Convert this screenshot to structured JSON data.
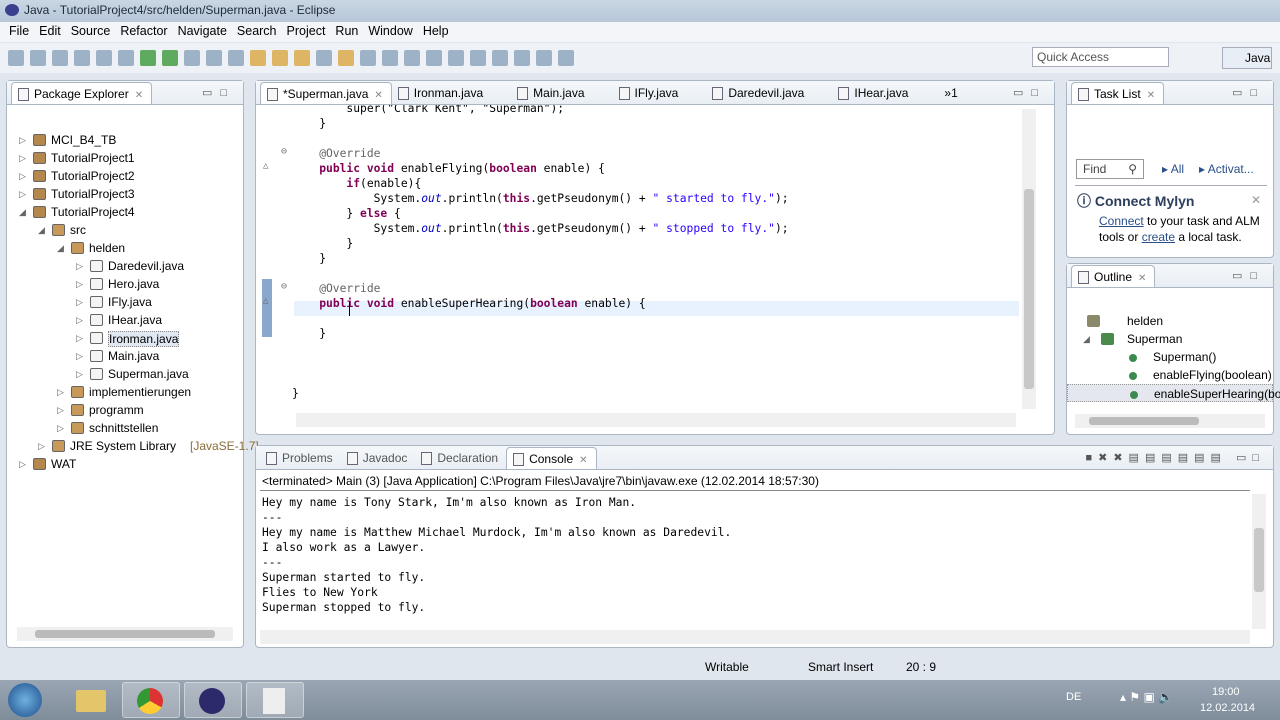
{
  "window": {
    "title": "Java - TutorialProject4/src/helden/Superman.java - Eclipse"
  },
  "menu": [
    "File",
    "Edit",
    "Source",
    "Refactor",
    "Navigate",
    "Search",
    "Project",
    "Run",
    "Window",
    "Help"
  ],
  "quick_access": {
    "placeholder": "Quick Access"
  },
  "perspective": "Java",
  "package_explorer": {
    "title": "Package Explorer",
    "items": [
      {
        "label": "MCI_B4_TB",
        "level": 0,
        "twisty": "closed"
      },
      {
        "label": "TutorialProject1",
        "level": 0,
        "twisty": "closed"
      },
      {
        "label": "TutorialProject2",
        "level": 0,
        "twisty": "closed"
      },
      {
        "label": "TutorialProject3",
        "level": 0,
        "twisty": "closed"
      },
      {
        "label": "TutorialProject4",
        "level": 0,
        "twisty": "open"
      },
      {
        "label": "src",
        "level": 1,
        "twisty": "open"
      },
      {
        "label": "helden",
        "level": 2,
        "twisty": "open"
      },
      {
        "label": "Daredevil.java",
        "level": 3,
        "twisty": "closed"
      },
      {
        "label": "Hero.java",
        "level": 3,
        "twisty": "closed"
      },
      {
        "label": "IFly.java",
        "level": 3,
        "twisty": "closed"
      },
      {
        "label": "IHear.java",
        "level": 3,
        "twisty": "closed"
      },
      {
        "label": "Ironman.java",
        "level": 3,
        "twisty": "closed",
        "selected": true
      },
      {
        "label": "Main.java",
        "level": 3,
        "twisty": "closed"
      },
      {
        "label": "Superman.java",
        "level": 3,
        "twisty": "closed"
      },
      {
        "label": "implementierungen",
        "level": 2,
        "twisty": "closed"
      },
      {
        "label": "programm",
        "level": 2,
        "twisty": "closed"
      },
      {
        "label": "schnittstellen",
        "level": 2,
        "twisty": "closed"
      },
      {
        "label": "JRE System Library",
        "suffix": "[JavaSE-1.7]",
        "level": 1,
        "twisty": "closed"
      },
      {
        "label": "WAT",
        "level": 0,
        "twisty": "closed"
      }
    ]
  },
  "editor": {
    "tabs": [
      "*Superman.java",
      "Ironman.java",
      "Main.java",
      "IFly.java",
      "Daredevil.java",
      "IHear.java"
    ],
    "overflow": "»1",
    "lines": [
      {
        "row": 0,
        "seg": [
          [
            "        super(\"Clark Kent\", \"Superman\");",
            ""
          ]
        ]
      },
      {
        "row": 1,
        "seg": [
          [
            "    }",
            ""
          ]
        ]
      },
      {
        "row": 3,
        "seg": [
          [
            "    @Override",
            "an"
          ]
        ]
      },
      {
        "row": 4,
        "seg": [
          [
            "    ",
            ""
          ],
          [
            "public void",
            "kw"
          ],
          [
            " enableFlying(",
            ""
          ],
          [
            "boolean",
            "kw"
          ],
          [
            " enable) {",
            ""
          ]
        ]
      },
      {
        "row": 5,
        "seg": [
          [
            "        ",
            ""
          ],
          [
            "if",
            "kw"
          ],
          [
            "(enable){",
            ""
          ]
        ]
      },
      {
        "row": 6,
        "seg": [
          [
            "            System.",
            ""
          ],
          [
            "out",
            "it"
          ],
          [
            ".println(",
            ""
          ],
          [
            "this",
            "kw"
          ],
          [
            ".getPseudonym() + ",
            ""
          ],
          [
            "\" started to fly.\"",
            "st"
          ],
          [
            ");",
            ""
          ]
        ]
      },
      {
        "row": 7,
        "seg": [
          [
            "        } ",
            ""
          ],
          [
            "else",
            "kw"
          ],
          [
            " {",
            ""
          ]
        ]
      },
      {
        "row": 8,
        "seg": [
          [
            "            System.",
            ""
          ],
          [
            "out",
            "it"
          ],
          [
            ".println(",
            ""
          ],
          [
            "this",
            "kw"
          ],
          [
            ".getPseudonym() + ",
            ""
          ],
          [
            "\" stopped to fly.\"",
            "st"
          ],
          [
            ");",
            ""
          ]
        ]
      },
      {
        "row": 9,
        "seg": [
          [
            "        }",
            ""
          ]
        ]
      },
      {
        "row": 10,
        "seg": [
          [
            "    }",
            ""
          ]
        ]
      },
      {
        "row": 12,
        "seg": [
          [
            "    @Override",
            "an"
          ]
        ]
      },
      {
        "row": 13,
        "seg": [
          [
            "    ",
            ""
          ],
          [
            "public void",
            "kw"
          ],
          [
            " enableSuperHearing(",
            ""
          ],
          [
            "boolean",
            "kw"
          ],
          [
            " enable) {",
            ""
          ]
        ]
      },
      {
        "row": 14,
        "seg": [
          [
            "        ",
            ""
          ]
        ]
      },
      {
        "row": 15,
        "seg": [
          [
            "    }",
            ""
          ]
        ]
      },
      {
        "row": 19,
        "seg": [
          [
            "}",
            ""
          ]
        ]
      }
    ]
  },
  "task_list": {
    "title": "Task List",
    "find_placeholder": "Find",
    "filter_all": "All",
    "filter_activate": "Activat...",
    "mylyn_title": "Connect Mylyn",
    "mylyn_link1": "Connect",
    "mylyn_text1": " to your task and ALM tools or ",
    "mylyn_link2": "create",
    "mylyn_text2": " a local task."
  },
  "outline": {
    "title": "Outline",
    "items": [
      {
        "label": "helden",
        "level": 0
      },
      {
        "label": "Superman",
        "level": 0
      },
      {
        "label": "Superman()",
        "level": 1
      },
      {
        "label": "enableFlying(boolean)",
        "level": 1
      },
      {
        "label": "enableSuperHearing(boolean)",
        "level": 1,
        "selected": true
      }
    ]
  },
  "console_view": {
    "tabs": [
      "Problems",
      "Javadoc",
      "Declaration",
      "Console"
    ],
    "header": "<terminated> Main (3) [Java Application] C:\\Program Files\\Java\\jre7\\bin\\javaw.exe (12.02.2014 18:57:30)",
    "lines": [
      "Hey my name is Tony Stark, Im'm also known as Iron Man.",
      "---",
      "Hey my name is Matthew Michael Murdock, Im'm also known as Daredevil.",
      "I also work as a Lawyer.",
      "---",
      "Superman started to fly.",
      "Flies to New York",
      "Superman stopped to fly."
    ]
  },
  "status": {
    "writable": "Writable",
    "insert_mode": "Smart Insert",
    "position": "20 : 9"
  },
  "taskbar": {
    "language": "DE",
    "time": "19:00",
    "date": "12.02.2014"
  }
}
